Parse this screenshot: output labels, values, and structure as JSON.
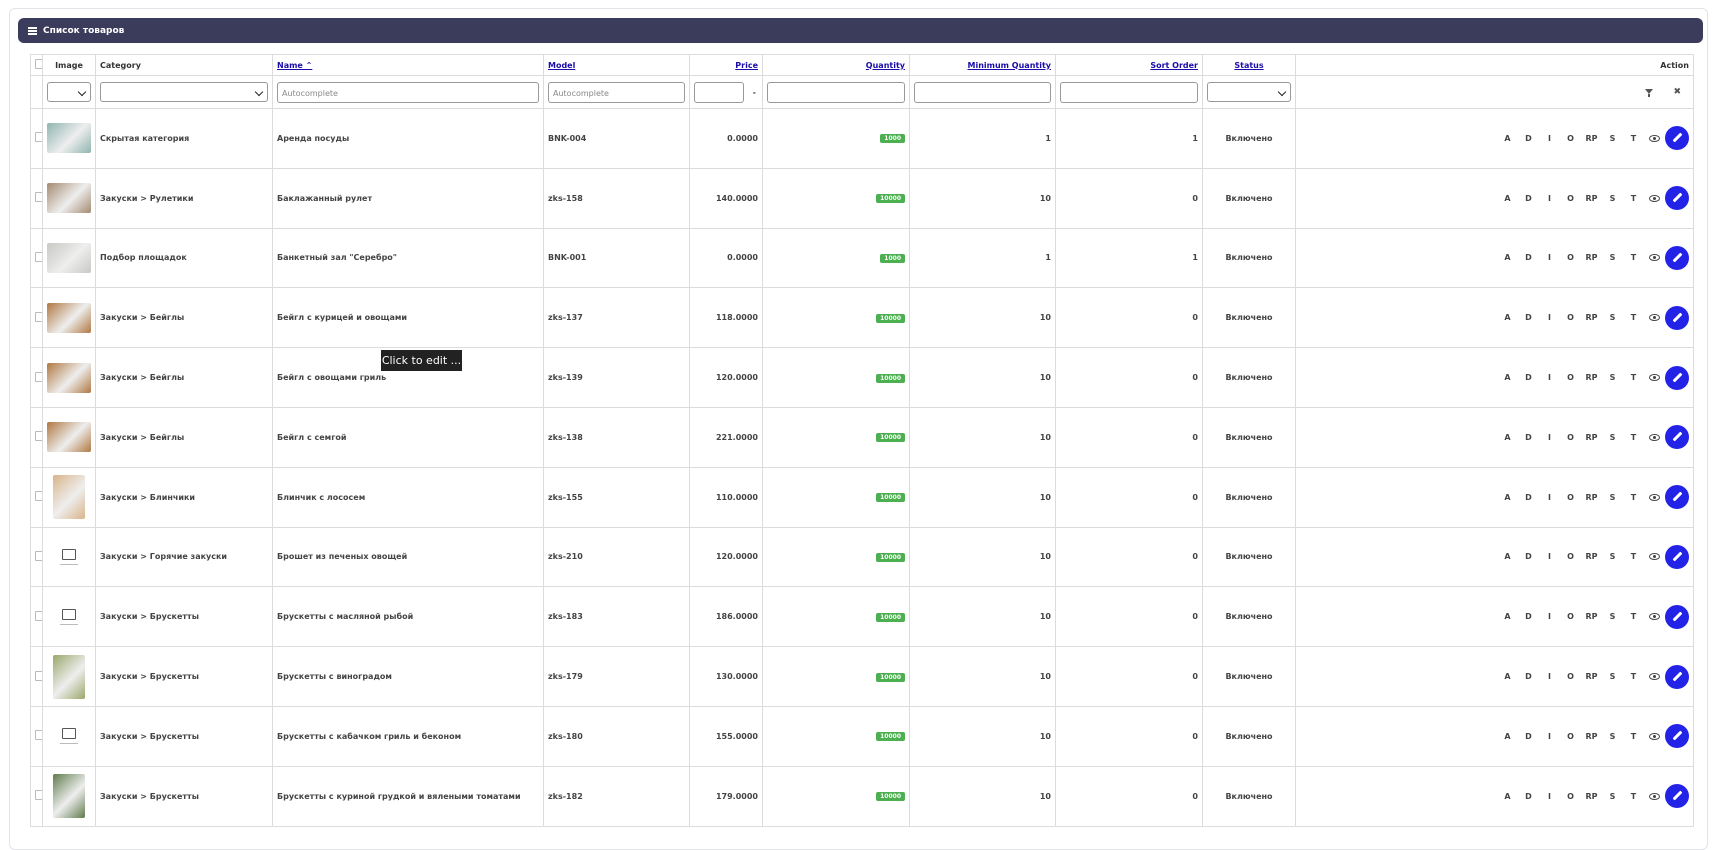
{
  "panel": {
    "title": "Список товаров",
    "icon": "list-icon"
  },
  "headers": {
    "image": "Image",
    "category": "Category",
    "name": "Name ⌃",
    "model": "Model",
    "price": "Price",
    "quantity": "Quantity",
    "minimum_quantity": "Minimum Quantity",
    "sort_order": "Sort Order",
    "status": "Status",
    "action": "Action"
  },
  "filters": {
    "name_placeholder": "Autocomplete",
    "model_placeholder": "Autocomplete",
    "price_separator": "-"
  },
  "action_labels": [
    "A",
    "D",
    "I",
    "O",
    "RP",
    "S",
    "T"
  ],
  "rows": [
    {
      "image": "photo",
      "category": "Скрытая категория",
      "name": "Аренда посуды",
      "model": "BNK-004",
      "price": "0.0000",
      "quantity": "1000",
      "min_qty": "1",
      "sort": "1",
      "status": "Включено",
      "thumb_color": "#8fb5b0"
    },
    {
      "image": "photo",
      "category": "Закуски > Рулетики",
      "name": "Баклажанный рулет",
      "model": "zks-158",
      "price": "140.0000",
      "quantity": "10000",
      "min_qty": "10",
      "sort": "0",
      "status": "Включено",
      "thumb_color": "#a48a70"
    },
    {
      "image": "photo",
      "category": "Подбор площадок",
      "name": "Банкетный зал \"Серебро\"",
      "model": "BNK-001",
      "price": "0.0000",
      "quantity": "1000",
      "min_qty": "1",
      "sort": "1",
      "status": "Включено",
      "thumb_color": "#c7c9c4"
    },
    {
      "image": "photo",
      "category": "Закуски > Бейглы",
      "name": "Бейгл с курицей и овощами",
      "model": "zks-137",
      "price": "118.0000",
      "quantity": "10000",
      "min_qty": "10",
      "sort": "0",
      "status": "Включено",
      "thumb_color": "#b07842"
    },
    {
      "image": "photo",
      "category": "Закуски > Бейглы",
      "name": "Бейгл с овощами гриль",
      "model": "zks-139",
      "price": "120.0000",
      "quantity": "10000",
      "min_qty": "10",
      "sort": "0",
      "status": "Включено",
      "thumb_color": "#b07842"
    },
    {
      "image": "photo",
      "category": "Закуски > Бейглы",
      "name": "Бейгл с семгой",
      "model": "zks-138",
      "price": "221.0000",
      "quantity": "10000",
      "min_qty": "10",
      "sort": "0",
      "status": "Включено",
      "thumb_color": "#b07842"
    },
    {
      "image": "photo-tall",
      "category": "Закуски > Блинчики",
      "name": "Блинчик с лососем",
      "model": "zks-155",
      "price": "110.0000",
      "quantity": "10000",
      "min_qty": "10",
      "sort": "0",
      "status": "Включено",
      "thumb_color": "#d9b48a"
    },
    {
      "image": "placeholder",
      "category": "Закуски > Горячие закуски",
      "name": "Брошет из печеных овощей",
      "model": "zks-210",
      "price": "120.0000",
      "quantity": "10000",
      "min_qty": "10",
      "sort": "0",
      "status": "Включено",
      "thumb_color": ""
    },
    {
      "image": "placeholder",
      "category": "Закуски > Брускетты",
      "name": "Брускетты с масляной рыбой",
      "model": "zks-183",
      "price": "186.0000",
      "quantity": "10000",
      "min_qty": "10",
      "sort": "0",
      "status": "Включено",
      "thumb_color": ""
    },
    {
      "image": "photo-tall",
      "category": "Закуски > Брускетты",
      "name": "Брускетты с виноградом",
      "model": "zks-179",
      "price": "130.0000",
      "quantity": "10000",
      "min_qty": "10",
      "sort": "0",
      "status": "Включено",
      "thumb_color": "#9aa86a"
    },
    {
      "image": "placeholder",
      "category": "Закуски > Брускетты",
      "name": "Брускетты с кабачком гриль и беконом",
      "model": "zks-180",
      "price": "155.0000",
      "quantity": "10000",
      "min_qty": "10",
      "sort": "0",
      "status": "Включено",
      "thumb_color": ""
    },
    {
      "image": "photo-tall",
      "category": "Закуски > Брускетты",
      "name": "Брускетты с куриной грудкой и вялеными томатами",
      "model": "zks-182",
      "price": "179.0000",
      "quantity": "10000",
      "min_qty": "10",
      "sort": "0",
      "status": "Включено",
      "thumb_color": "#5f7b4c"
    }
  ],
  "tooltip": "Click to edit ..."
}
